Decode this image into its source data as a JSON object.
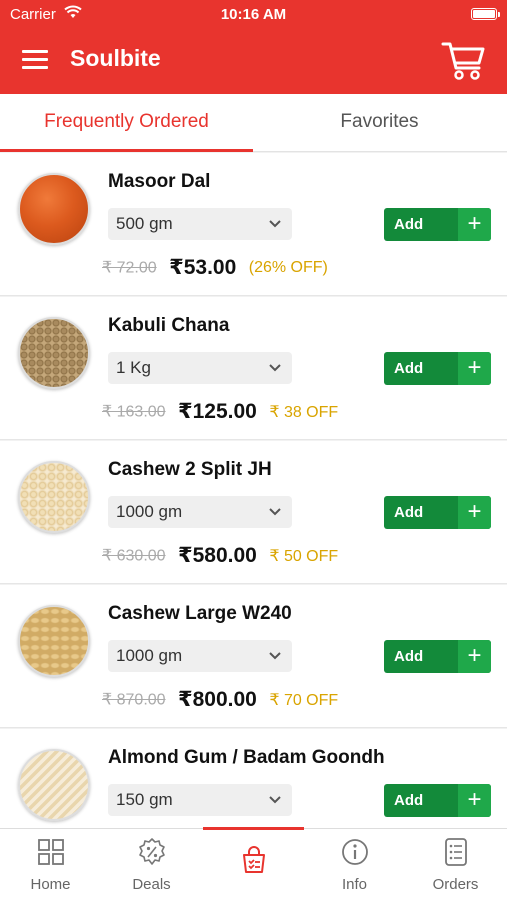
{
  "status_bar": {
    "carrier": "Carrier",
    "time": "10:16 AM"
  },
  "app_bar": {
    "title": "Soulbite",
    "menu_icon": "hamburger-menu-icon",
    "cart_icon": "shopping-cart-icon"
  },
  "tabs": [
    {
      "label": "Frequently Ordered",
      "active": true
    },
    {
      "label": "Favorites",
      "active": false
    }
  ],
  "products": [
    {
      "name": "Masoor Dal",
      "size": "500 gm",
      "add_label": "Add",
      "old_price": "₹ 72.00",
      "new_price": "₹53.00",
      "discount": "(26% OFF)",
      "image": "red-lentils"
    },
    {
      "name": "Kabuli Chana",
      "size": "1 Kg",
      "add_label": "Add",
      "old_price": "₹ 163.00",
      "new_price": "₹125.00",
      "discount": "₹ 38 OFF",
      "image": "chickpeas"
    },
    {
      "name": "Cashew 2 Split JH",
      "size": "1000 gm",
      "add_label": "Add",
      "old_price": "₹ 630.00",
      "new_price": "₹580.00",
      "discount": "₹ 50 OFF",
      "image": "split-cashews"
    },
    {
      "name": "Cashew Large W240",
      "size": "1000 gm",
      "add_label": "Add",
      "old_price": "₹ 870.00",
      "new_price": "₹800.00",
      "discount": "₹ 70 OFF",
      "image": "whole-cashews"
    },
    {
      "name": "Almond Gum / Badam Goondh",
      "size": "150 gm",
      "add_label": "Add",
      "old_price": "",
      "new_price": "",
      "discount": "",
      "image": "almond-gum"
    }
  ],
  "bottom_nav": [
    {
      "label": "Home",
      "icon": "grid-icon",
      "active": false
    },
    {
      "label": "Deals",
      "icon": "deals-badge-icon",
      "active": false
    },
    {
      "label": "",
      "icon": "shopping-bag-icon",
      "active": true
    },
    {
      "label": "Info",
      "icon": "info-icon",
      "active": false
    },
    {
      "label": "Orders",
      "icon": "orders-list-icon",
      "active": false
    }
  ],
  "colors": {
    "brand": "#e8342e",
    "add_button": "#138a3a",
    "add_plus": "#1fa84a",
    "discount": "#d9a400"
  }
}
